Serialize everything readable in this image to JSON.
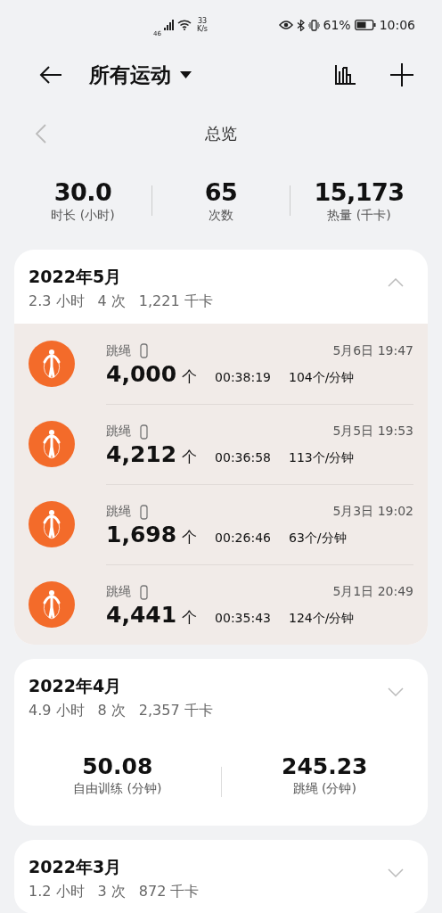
{
  "status_bar": {
    "network": "46",
    "speed": "33",
    "speed_unit": "K/s",
    "battery": "61%",
    "time": "10:06"
  },
  "header": {
    "title": "所有运动"
  },
  "overview": {
    "title": "总览",
    "stats": [
      {
        "value": "30.0",
        "label": "时长 (小时)"
      },
      {
        "value": "65",
        "label": "次数"
      },
      {
        "value": "15,173",
        "label": "热量 (千卡)"
      }
    ]
  },
  "months": [
    {
      "title": "2022年5月",
      "duration": "2.3 小时",
      "count": "4 次",
      "calories": "1,221 千卡",
      "expanded": true,
      "records": [
        {
          "name": "跳绳",
          "date": "5月6日 19:47",
          "reps": "4,000",
          "unit": "个",
          "time": "00:38:19",
          "rate": "104个/分钟"
        },
        {
          "name": "跳绳",
          "date": "5月5日 19:53",
          "reps": "4,212",
          "unit": "个",
          "time": "00:36:58",
          "rate": "113个/分钟"
        },
        {
          "name": "跳绳",
          "date": "5月3日 19:02",
          "reps": "1,698",
          "unit": "个",
          "time": "00:26:46",
          "rate": "63个/分钟"
        },
        {
          "name": "跳绳",
          "date": "5月1日 20:49",
          "reps": "4,441",
          "unit": "个",
          "time": "00:35:43",
          "rate": "124个/分钟"
        }
      ]
    },
    {
      "title": "2022年4月",
      "duration": "4.9 小时",
      "count": "8 次",
      "calories": "2,357 千卡",
      "expanded": false,
      "breakdown": [
        {
          "value": "50.08",
          "label": "自由训练 (分钟)"
        },
        {
          "value": "245.23",
          "label": "跳绳 (分钟)"
        }
      ]
    },
    {
      "title": "2022年3月",
      "duration": "1.2 小时",
      "count": "3 次",
      "calories": "872 千卡",
      "expanded": false
    }
  ]
}
